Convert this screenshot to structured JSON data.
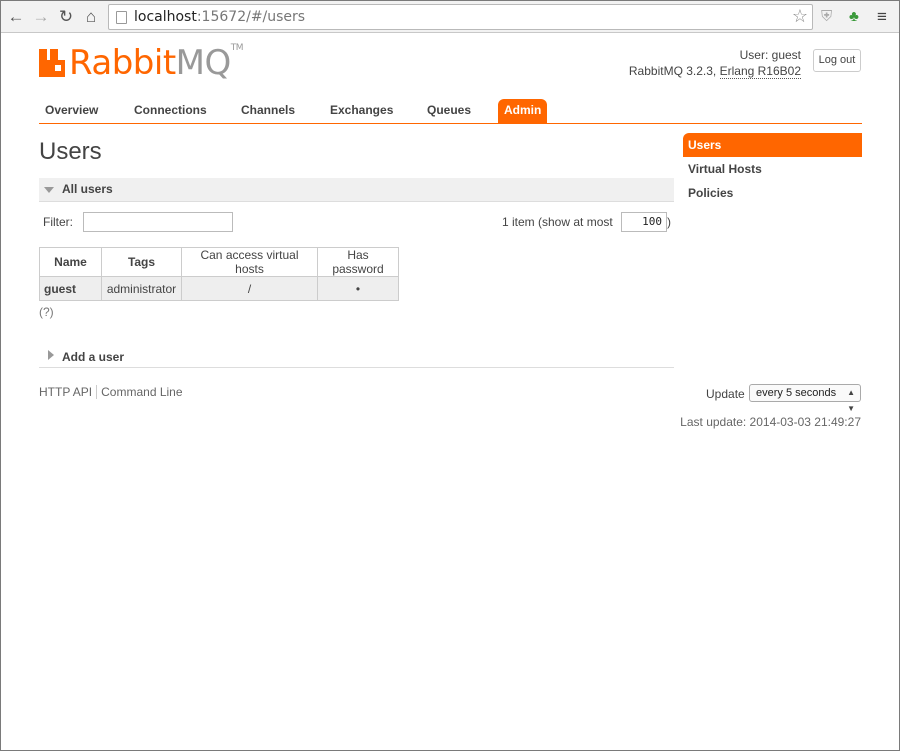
{
  "browser": {
    "url_host": "localhost",
    "url_rest": ":15672/#/users",
    "icons": [
      "back-icon",
      "forward-icon",
      "reload-icon",
      "home-icon",
      "star-icon",
      "shield-icon",
      "extension-icon",
      "menu-icon"
    ]
  },
  "header": {
    "logo_main": "Rabbit",
    "logo_mq": "MQ",
    "logo_tm": "TM",
    "user_label": "User: guest",
    "version": "RabbitMQ 3.2.3,",
    "erlang": "Erlang R16B02",
    "logout": "Log out"
  },
  "tabs": [
    "Overview",
    "Connections",
    "Channels",
    "Exchanges",
    "Queues",
    "Admin"
  ],
  "active_tab": "Admin",
  "page_title": "Users",
  "all_users": {
    "heading": "All users",
    "filter_label": "Filter:",
    "filter_value": "",
    "count_text": "1 item (show at most",
    "max_value": "100",
    "close_paren": ")",
    "columns": [
      "Name",
      "Tags",
      "Can access virtual hosts",
      "Has password"
    ],
    "rows": [
      {
        "name": "guest",
        "tags": "administrator",
        "vhosts": "/",
        "has_password": "•"
      }
    ],
    "help": "(?)"
  },
  "add_user": {
    "heading": "Add a user"
  },
  "footer": {
    "http_api": "HTTP API",
    "command_line": "Command Line",
    "update_label": "Update",
    "update_value": "every 5 seconds",
    "last_update": "Last update: 2014-03-03 21:49:27"
  },
  "sidebar": [
    "Users",
    "Virtual Hosts",
    "Policies"
  ],
  "colors": {
    "accent": "#ff6600",
    "section_bg": "#f0f0f0"
  }
}
